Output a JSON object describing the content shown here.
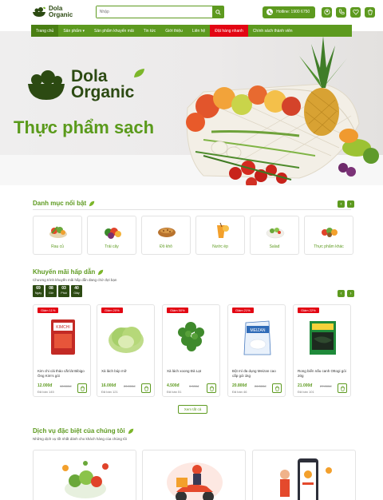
{
  "header": {
    "logo_line1": "Dola",
    "logo_line2": "Organic",
    "search_placeholder": "Nhập",
    "hotline_label": "Hotline: 1900 6750",
    "icons": [
      "account-icon",
      "phone-icon",
      "heart-icon",
      "cart-icon"
    ]
  },
  "nav": {
    "items": [
      {
        "label": "Trang chủ"
      },
      {
        "label": "Sản phẩm ▾"
      },
      {
        "label": "Sản phẩm khuyến mãi"
      },
      {
        "label": "Tin tức"
      },
      {
        "label": "Giới thiệu"
      },
      {
        "label": "Liên hệ"
      },
      {
        "label": "Đặt hàng nhanh"
      },
      {
        "label": "Chính sách thành viên"
      }
    ]
  },
  "hero": {
    "brand_line1": "Dola",
    "brand_line2": "Organic",
    "tagline": "Thực phẩm sạch"
  },
  "categories": {
    "title": "Danh mục nổi bật",
    "items": [
      {
        "label": "Rau củ"
      },
      {
        "label": "Trái cây"
      },
      {
        "label": "Đồ khô"
      },
      {
        "label": "Nước ép"
      },
      {
        "label": "Salad"
      },
      {
        "label": "Thực phẩm khác"
      }
    ]
  },
  "promo": {
    "title": "Khuyến mãi hấp dẫn",
    "subtitle": "Chương trình khuyến mãi hấp dẫn đang chờ đợi bạn",
    "countdown": [
      {
        "value": "69",
        "unit": "Ngày"
      },
      {
        "value": "08",
        "unit": "Giờ"
      },
      {
        "value": "03",
        "unit": "Phút"
      },
      {
        "value": "40",
        "unit": "Giây"
      }
    ],
    "products": [
      {
        "badge": "Giảm 11%",
        "name": "Kim chi cải thảo cắt lát Bibigo Ông Kim's gói",
        "price": "12.000đ",
        "old": "13.500đ",
        "sold": "Đã bán 145"
      },
      {
        "badge": "Giảm 20%",
        "name": "Xà lách búp mỡ",
        "price": "16.000đ",
        "old": "20.000đ",
        "sold": "Đã bán 121"
      },
      {
        "badge": "Giảm 50%",
        "name": "Xà lách xoong Đà Lạt",
        "price": "4.500đ",
        "old": "9.000đ",
        "sold": "Đã bán 51"
      },
      {
        "badge": "Giảm 21%",
        "name": "Bột mì đa dụng Meizan cao cấp gói 1kg",
        "price": "20.800đ",
        "old": "26.300đ",
        "sold": "Đã bán 46"
      },
      {
        "badge": "Giảm 22%",
        "name": "Rong biển nấu canh Ottogi gói 20g",
        "price": "21.000đ",
        "old": "27.000đ",
        "sold": "Đã bán 101"
      }
    ],
    "view_all": "Xem tất cả"
  },
  "services": {
    "title": "Dịch vụ đặc biệt của chúng tôi",
    "subtitle": "Những dịch vụ tốt nhất dành cho khách hàng của chúng tôi"
  },
  "colors": {
    "primary": "#5d9a1f",
    "dark": "#2c4a12",
    "sale": "#e30613"
  }
}
